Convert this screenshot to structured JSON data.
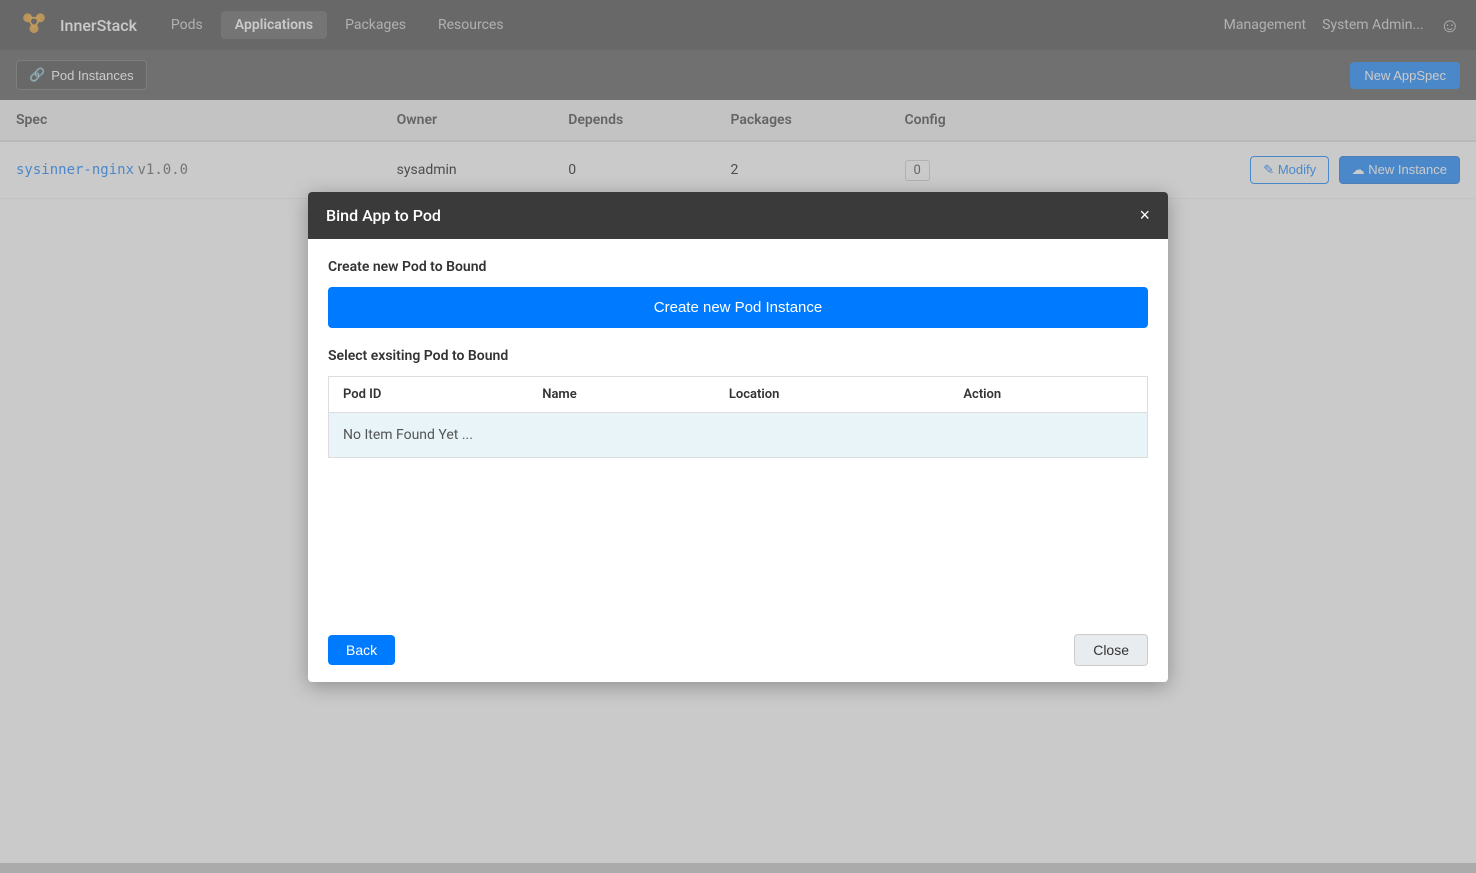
{
  "navbar": {
    "brand": "InnerStack",
    "nav_items": [
      {
        "label": "Pods",
        "active": false
      },
      {
        "label": "Applications",
        "active": true
      },
      {
        "label": "Packages",
        "active": false
      },
      {
        "label": "Resources",
        "active": false
      }
    ],
    "management_label": "Management",
    "user_label": "System Admin..."
  },
  "subtoolbar": {
    "pod_instances_label": "Pod Instances",
    "new_appspec_label": "New AppSpec"
  },
  "table": {
    "columns": [
      "Spec",
      "Owner",
      "Depends",
      "Packages",
      "Config"
    ],
    "rows": [
      {
        "spec_link": "sysinner-nginx",
        "spec_version": "v1.0.0",
        "owner": "sysadmin",
        "depends": "0",
        "packages": "2",
        "config": "0"
      }
    ],
    "modify_label": "Modify",
    "new_instance_label": "New Instance"
  },
  "modal": {
    "title": "Bind App to Pod",
    "create_section_label": "Create new Pod to Bound",
    "create_button_label": "Create new Pod Instance",
    "select_section_label": "Select exsiting Pod to Bound",
    "columns": [
      "Pod ID",
      "Name",
      "Location",
      "Action"
    ],
    "no_item_text": "No Item Found Yet ...",
    "back_label": "Back",
    "close_label": "Close"
  }
}
